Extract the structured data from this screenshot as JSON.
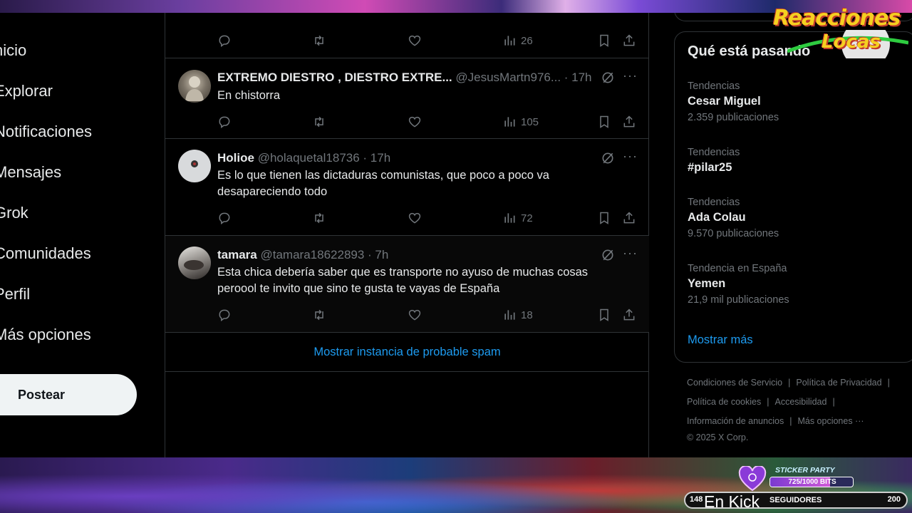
{
  "nav": {
    "items": [
      {
        "label": "Inicio",
        "visible": "nicio"
      },
      {
        "label": "Explorar",
        "visible": "Explorar"
      },
      {
        "label": "Notificaciones",
        "visible": "Notificaciones"
      },
      {
        "label": "Mensajes",
        "visible": "Mensajes"
      },
      {
        "label": "Grok",
        "visible": "Grok"
      },
      {
        "label": "Comunidades",
        "visible": "Comunidades"
      },
      {
        "label": "Perfil",
        "visible": "Perfil"
      },
      {
        "label": "Más opciones",
        "visible": "Más opciones"
      }
    ],
    "post_button": "Postear"
  },
  "feed": {
    "top_tweet_actions": {
      "views": "26"
    },
    "tweets": [
      {
        "name": "EXTREMO DIESTRO , DIESTRO EXTRE...",
        "meta": "@JesusMartn976... · 17h",
        "text": "En chistorra",
        "views": "105"
      },
      {
        "name": "Holioe",
        "meta": "@holaquetal18736 · 17h",
        "text": "Es lo que tienen las dictaduras comunistas, que poco a poco va desapareciendo todo",
        "views": "72"
      },
      {
        "name": "tamara",
        "meta": "@tamara18622893 · 7h",
        "text": "Esta chica debería saber que es transporte no ayuso de muchas cosas peroool te invito que sino te gusta te vayas de España",
        "views": "18"
      }
    ],
    "spam_link": "Mostrar instancia de probable spam"
  },
  "trends": {
    "title": "Qué está pasando",
    "items": [
      {
        "category": "Tendencias",
        "name": "Cesar Miguel",
        "count": "2.359 publicaciones"
      },
      {
        "category": "Tendencias",
        "name": "#pilar25",
        "count": ""
      },
      {
        "category": "Tendencias",
        "name": "Ada Colau",
        "count": "9.570 publicaciones"
      },
      {
        "category": "Tendencia en España",
        "name": "Yemen",
        "count": "21,9 mil publicaciones"
      }
    ],
    "show_more": "Mostrar más"
  },
  "footer": {
    "terms": "Condiciones de Servicio",
    "privacy": "Política de Privacidad",
    "cookies": "Política de cookies",
    "accessibility": "Accesibilidad",
    "ads_info": "Información de anuncios",
    "more": "Más opciones ···",
    "copyright": "© 2025 X Corp."
  },
  "overlay": {
    "logo_line1": "Reacciones",
    "logo_line2": "Locas",
    "sticker_title": "STICKER PARTY",
    "sticker_progress_text": "725/1000 BITS",
    "sticker_progress_fraction": 0.725,
    "kick_left_num": "148",
    "kick_label": "En Kick",
    "kick_followers": "SEGUIDORES",
    "kick_right_num": "200"
  },
  "colors": {
    "background": "#000000",
    "accent": "#1d9bf0",
    "text": "#e7e9ea",
    "muted": "#71767b",
    "border": "#2f3336"
  }
}
